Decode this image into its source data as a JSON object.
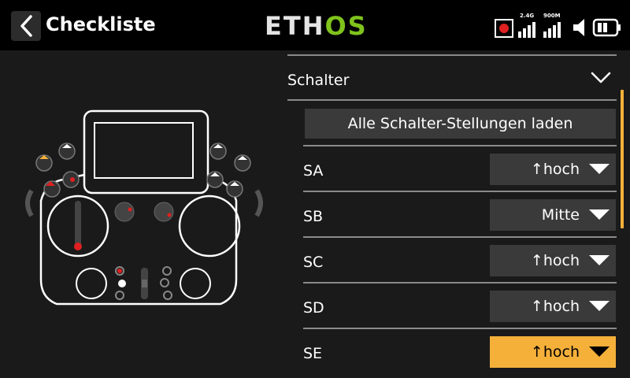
{
  "header": {
    "title": "Checkliste",
    "logo_left": "ETH",
    "logo_right": "OS",
    "signal_1_label": "2.4G",
    "signal_2_label": "900M"
  },
  "section": {
    "label": "Schalter",
    "load_button": "Alle Schalter-Stellungen laden"
  },
  "switches": [
    {
      "name": "SA",
      "value": "↑hoch"
    },
    {
      "name": "SB",
      "value": "Mitte"
    },
    {
      "name": "SC",
      "value": "↑hoch"
    },
    {
      "name": "SD",
      "value": "↑hoch"
    },
    {
      "name": "SE",
      "value": "↑hoch"
    }
  ],
  "colors": {
    "accent": "#f5b03a",
    "logo_green": "#7fc31c",
    "indicator_red": "#e02020",
    "bg": "#1a1a1a",
    "topbar": "#000000",
    "field": "#3a3a3a"
  },
  "icons": {
    "back": "chevron-left-icon",
    "collapse": "chevron-down-icon",
    "record": "record-icon",
    "volume": "speaker-icon",
    "battery": "battery-icon"
  }
}
